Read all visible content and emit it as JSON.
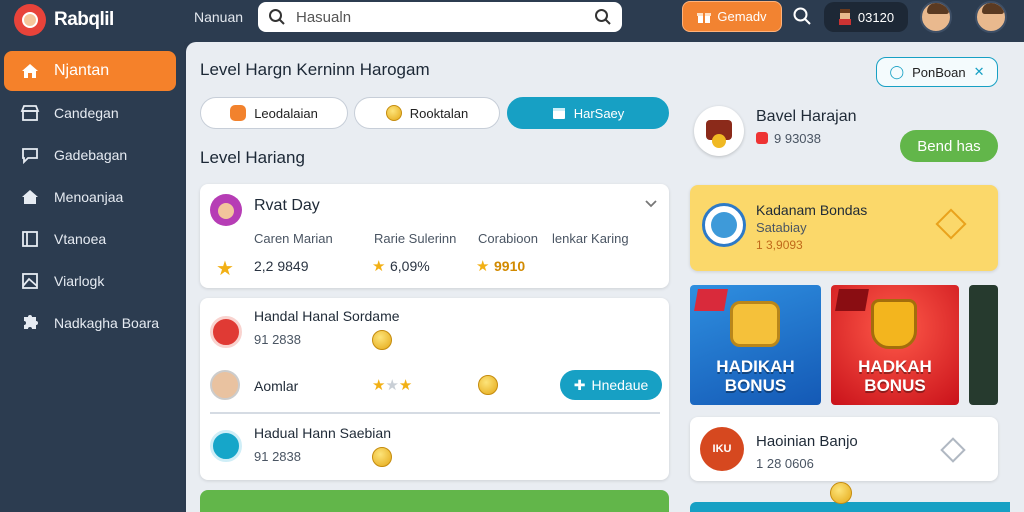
{
  "app": {
    "name": "Rabqlil"
  },
  "topbar": {
    "nav_label": "Nanuan",
    "search_placeholder": "Hasualn",
    "promo_label": "Gemadv",
    "balance": "03120"
  },
  "sidebar": {
    "items": [
      {
        "label": "Njantan",
        "icon": "home-icon",
        "active": true
      },
      {
        "label": "Candegan",
        "icon": "store-icon"
      },
      {
        "label": "Gadebagan",
        "icon": "chat-icon"
      },
      {
        "label": "Menoanjaa",
        "icon": "house-icon"
      },
      {
        "label": "Vtanoea",
        "icon": "list-icon"
      },
      {
        "label": "Viarlogk",
        "icon": "image-icon"
      },
      {
        "label": "Nadkagha Boara",
        "icon": "puzzle-icon"
      }
    ]
  },
  "main": {
    "heading": "Level Hargn Kerninn Harogam",
    "filters": [
      {
        "label": "Leodalaian",
        "color": "#f2822d"
      },
      {
        "label": "Rooktalan",
        "color": "#f2c318"
      },
      {
        "label": "HarSaey",
        "active": true
      }
    ],
    "section_title": "Level Hariang",
    "level_card": {
      "title": "Rvat Day",
      "col_labels": [
        "Caren Marian",
        "Rarie Sulerinn",
        "Corabioon",
        "lenkar Karing"
      ],
      "values": [
        "2,2 9849",
        "6,09%",
        "9910"
      ]
    },
    "list_card": {
      "row1": {
        "title": "Handal Hanal Sordame",
        "value": "91 2838"
      },
      "row2": {
        "name": "Aomlar",
        "button": "Hnedaue"
      },
      "row3": {
        "title": "Hadual Hann Saebian",
        "value": "91 2838"
      }
    }
  },
  "right": {
    "profile": {
      "name": "Bavel Harajan",
      "code": "9 93038",
      "button": "Bend has"
    },
    "bonus_card": {
      "title": "Kadanam Bondas",
      "subtitle": "Satabiay",
      "value": "1 3,9093"
    },
    "promo_tiles": [
      {
        "line1": "HADIKAH",
        "line2": "BONUS"
      },
      {
        "line1": "HADKAH",
        "line2": "BONUS"
      }
    ],
    "bottom_card": {
      "title": "Haoinian Banjo",
      "value": "1 28 0606",
      "badge": "IKU"
    }
  },
  "colors": {
    "accent_orange": "#f5812a",
    "accent_teal": "#17a0c4",
    "accent_green": "#62b64a"
  },
  "header_button": {
    "label": "PonBoan"
  }
}
